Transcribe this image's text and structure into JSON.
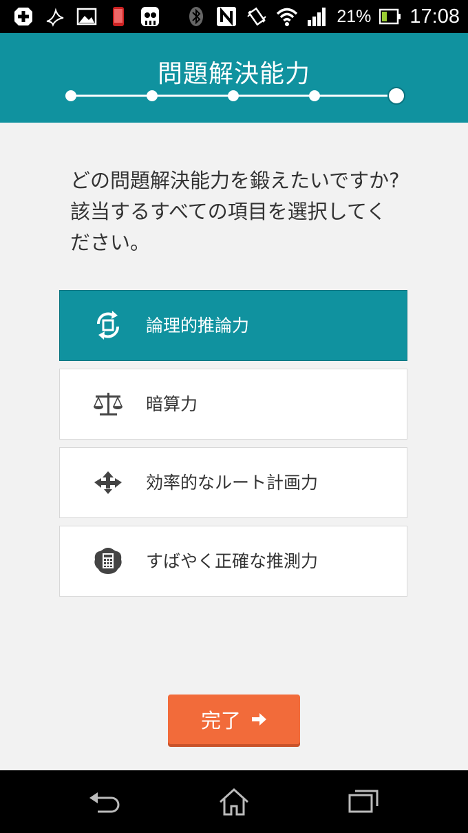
{
  "status_bar": {
    "battery_percent": "21%",
    "time": "17:08",
    "icons": [
      "plus-icon",
      "bird-icon",
      "image-icon",
      "phone-icon",
      "ghost-icon",
      "bluetooth-icon",
      "nfc-icon",
      "vibrate-icon",
      "wifi-icon",
      "signal-icon",
      "battery-icon"
    ]
  },
  "header": {
    "title": "問題解決能力",
    "progress_steps": 5,
    "current_step": 5
  },
  "question": {
    "text": "どの問題解決能力を鍛えたいですか?該当するすべての項目を選択してください。"
  },
  "options": [
    {
      "label": "論理的推論力",
      "icon": "rotate-arrows-icon",
      "selected": true
    },
    {
      "label": "暗算力",
      "icon": "scale-icon",
      "selected": false
    },
    {
      "label": "効率的なルート計画力",
      "icon": "route-arrows-icon",
      "selected": false
    },
    {
      "label": "すばやく正確な推測力",
      "icon": "calculator-icon",
      "selected": false
    }
  ],
  "done_button": {
    "label": "完了",
    "icon": "arrow-right-icon"
  },
  "nav_bar": {
    "icons": [
      "back-icon",
      "home-icon",
      "recent-apps-icon"
    ]
  },
  "colors": {
    "teal": "#10929f",
    "orange": "#f26b3a",
    "background": "#f2f2f2"
  }
}
